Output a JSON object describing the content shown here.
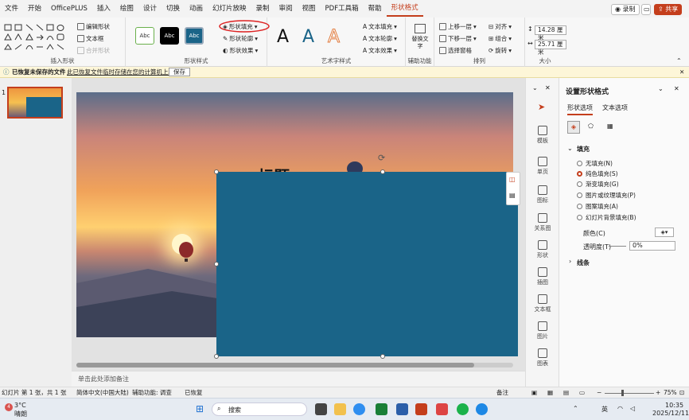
{
  "menu": [
    "文件",
    "开始",
    "OfficePLUS",
    "插入",
    "绘图",
    "设计",
    "切换",
    "动画",
    "幻灯片放映",
    "录制",
    "审阅",
    "视图",
    "PDF工具箱",
    "帮助",
    "形状格式"
  ],
  "topright": {
    "record": "录制",
    "share": "共享"
  },
  "ribbon": {
    "insert_shapes": {
      "edit_shape": "编辑形状",
      "textbox": "文本框",
      "merge_shapes": "合并形状",
      "label": "插入形状"
    },
    "shape_styles": {
      "samples": [
        "Abc",
        "Abc",
        "Abc"
      ],
      "fill": "形状填充",
      "outline": "形状轮廓",
      "effects": "形状效果",
      "label": "形状样式"
    },
    "wordart": {
      "letters": [
        "A",
        "A",
        "A"
      ],
      "text_fill": "文本填充",
      "text_outline": "文本轮廓",
      "text_effects": "文本效果",
      "label": "艺术字样式"
    },
    "accessibility": {
      "alt_text": "替换文字",
      "label": "辅助功能"
    },
    "arrange": {
      "bring_forward": "上移一层",
      "send_backward": "下移一层",
      "selection_pane": "选择窗格",
      "align": "对齐",
      "group": "组合",
      "rotate": "旋转",
      "label": "排列"
    },
    "size": {
      "height": "14.28 厘米",
      "width": "25.71 厘米",
      "label": "大小"
    }
  },
  "infobar": {
    "title": "已恢复未保存的文件",
    "message": "此已恢复文件临时存储在您的计算机上。",
    "save": "保存"
  },
  "thumbnail": {
    "number": "1"
  },
  "slide": {
    "title": "标题",
    "notes": "单击此处添加备注"
  },
  "side_icons": [
    "模板",
    "单页",
    "图标",
    "关系图",
    "形状",
    "插图",
    "文本框",
    "图片",
    "图表"
  ],
  "format_pane": {
    "title": "设置形状格式",
    "tabs": [
      "形状选项",
      "文本选项"
    ],
    "fill_section": "填充",
    "fill_options": [
      "无填充(N)",
      "纯色填充(S)",
      "渐变填充(G)",
      "图片或纹理填充(P)",
      "图案填充(A)",
      "幻灯片背景填充(B)"
    ],
    "selected_fill": 1,
    "color_label": "颜色(C)",
    "transparency_label": "透明度(T)",
    "transparency_value": "0%",
    "line_section": "线条"
  },
  "status": {
    "slide_info": "幻灯片 第 1 张，共 1 张",
    "language": "简体中文(中国大陆)",
    "accessibility": "辅助功能: 调查",
    "recovered": "已恢复",
    "notes": "备注",
    "zoom": "75%"
  },
  "taskbar": {
    "temp": "3°C",
    "weather": "晴朗",
    "search": "搜索",
    "ime": "英",
    "time": "10:35",
    "date": "2025/12/11",
    "badge": "4"
  },
  "colors": {
    "accent": "#c43e1c",
    "shape_fill": "#1a6488",
    "infobar": "#fdf6d8"
  }
}
